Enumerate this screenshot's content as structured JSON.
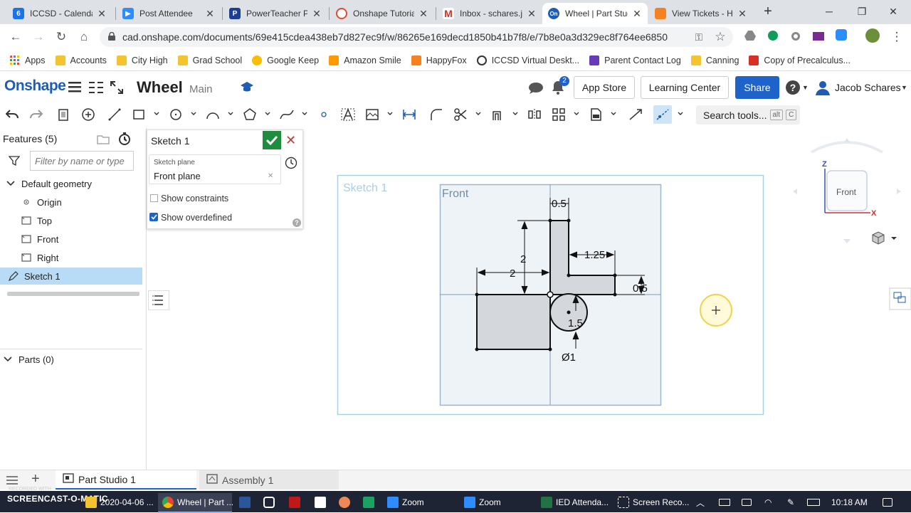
{
  "browser": {
    "tabs": [
      {
        "title": "ICCSD - Calendar",
        "favicon": "calendar-icon",
        "badge": "6"
      },
      {
        "title": "Post Attendee",
        "favicon": "zoom-icon"
      },
      {
        "title": "PowerTeacher Pro",
        "favicon": "powerschool-icon",
        "badge": "P"
      },
      {
        "title": "Onshape Tutorials",
        "favicon": "onshape-tutorial-icon"
      },
      {
        "title": "Inbox - schares.j",
        "favicon": "gmail-icon",
        "badge": "M"
      },
      {
        "title": "Wheel | Part Studio",
        "favicon": "onshape-icon",
        "badge": "On",
        "active": true
      },
      {
        "title": "View Tickets - Ha",
        "favicon": "happyfox-icon"
      }
    ],
    "new_tab": "+",
    "url": "cad.onshape.com/documents/69e415cdea438eb7d827ec9f/w/86265e169decd1850b41b7f8/e/7b8e0a3d329ec8f764ee6850",
    "bookmarks": [
      {
        "label": "Apps",
        "icon": "apps-grid-icon"
      },
      {
        "label": "Accounts",
        "icon": "folder-icon"
      },
      {
        "label": "City High",
        "icon": "folder-icon"
      },
      {
        "label": "Grad School",
        "icon": "folder-icon"
      },
      {
        "label": "Google Keep",
        "icon": "keep-icon"
      },
      {
        "label": "Amazon Smile",
        "icon": "amazon-icon"
      },
      {
        "label": "HappyFox",
        "icon": "happyfox-icon"
      },
      {
        "label": "ICCSD Virtual Deskt...",
        "icon": "citrix-icon"
      },
      {
        "label": "Parent Contact Log",
        "icon": "forms-icon"
      },
      {
        "label": "Canning",
        "icon": "folder-icon"
      },
      {
        "label": "Copy of Precalculus...",
        "icon": "pdf-icon"
      }
    ]
  },
  "onshape": {
    "logo": "Onshape",
    "document_name": "Wheel",
    "branch": "Main",
    "notification_count": "2",
    "app_store": "App Store",
    "learning_center": "Learning Center",
    "share": "Share",
    "user": "Jacob Schares",
    "search_tools": "Search tools...",
    "search_shortcut_1": "alt",
    "search_shortcut_2": "C"
  },
  "features": {
    "title": "Features (5)",
    "filter_placeholder": "Filter by name or type",
    "group": "Default geometry",
    "items": [
      "Origin",
      "Top",
      "Front",
      "Right"
    ],
    "sketch": "Sketch 1",
    "parts": "Parts (0)"
  },
  "sketch_dialog": {
    "title": "Sketch 1",
    "plane_label": "Sketch plane",
    "plane_value": "Front plane",
    "show_constraints": "Show constraints",
    "show_constraints_checked": false,
    "show_overdefined": "Show overdefined",
    "show_overdefined_checked": true
  },
  "canvas": {
    "sketch_label": "Sketch 1",
    "plane_label": "Front",
    "dimensions": [
      "0.5",
      "2",
      "2",
      "1.25",
      "0.5",
      "1.5",
      "Ø1"
    ],
    "view_cube_label": "Front",
    "axis_z": "Z",
    "axis_x": "X"
  },
  "bottom_tabs": [
    {
      "label": "Part Studio 1",
      "active": true
    },
    {
      "label": "Assembly 1",
      "active": false
    }
  ],
  "taskbar": {
    "recorded_with": "RECORDED WITH",
    "brand": "SCREENCAST-O-MATIC",
    "items": [
      {
        "label": "2020-04-06 ..."
      },
      {
        "label": "Wheel | Part ...",
        "active": true
      },
      {
        "label": "Zoom"
      },
      {
        "label": "Zoom"
      },
      {
        "label": "IED Attenda..."
      },
      {
        "label": "Screen Reco..."
      }
    ],
    "clock": "10:18 AM"
  },
  "colors": {
    "onshape_blue": "#1f5db5",
    "share_bg": "#1d63c9",
    "selected_row": "#b8dcf5",
    "sketch_fill": "#d4d7dc",
    "confirm_green": "#1e8e3e",
    "cancel_red": "#d93025"
  }
}
